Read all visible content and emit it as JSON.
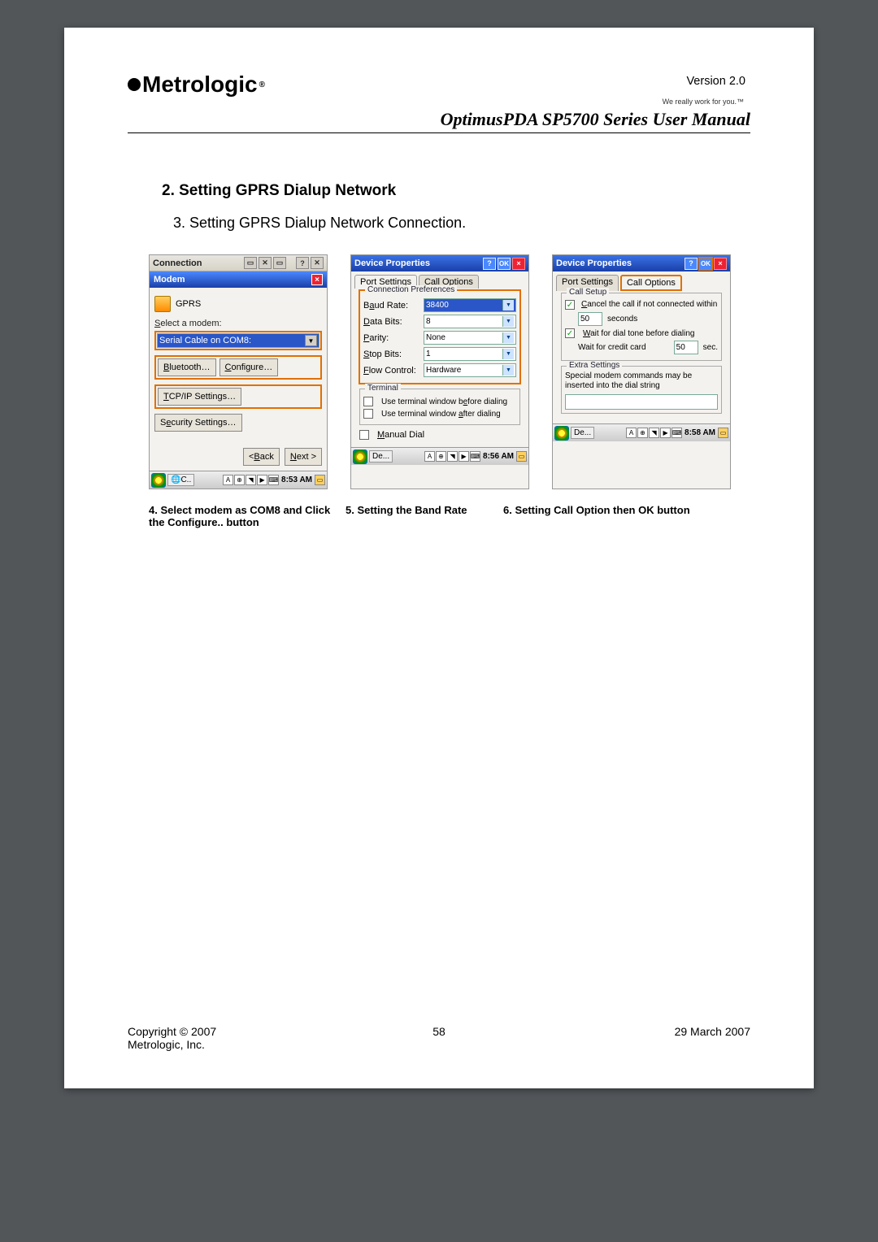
{
  "header": {
    "version": "Version 2.0",
    "logo_text": "Metrologic",
    "logo_tag": "We really work for you.™",
    "manual_title": "OptimusPDA SP5700 Series User Manual"
  },
  "section": {
    "heading": "2. Setting GPRS Dialup Network",
    "sub": "3. Setting GPRS Dialup Network Connection."
  },
  "shot1": {
    "window_title": "Connection",
    "sub_title": "Modem",
    "gprs": "GPRS",
    "select_modem_label": "Select a modem:",
    "modem_value": "Serial Cable on COM8:",
    "btn_bluetooth": "Bluetooth…",
    "btn_configure": "Configure…",
    "btn_tcpip": "TCP/IP Settings…",
    "btn_security": "Security Settings…",
    "btn_back": "< Back",
    "btn_next": "Next >",
    "task_label": "C..",
    "time": "8:53 AM"
  },
  "shot2": {
    "window_title": "Device Properties",
    "tab1": "Port Settings",
    "tab2": "Call Options",
    "fieldset1": "Connection Preferences",
    "baud_label": "Baud Rate:",
    "baud_value": "38400",
    "databits_label": "Data Bits:",
    "databits_value": "8",
    "parity_label": "Parity:",
    "parity_value": "None",
    "stopbits_label": "Stop Bits:",
    "stopbits_value": "1",
    "flow_label": "Flow Control:",
    "flow_value": "Hardware",
    "fieldset2": "Terminal",
    "term_before": "Use terminal window before dialing",
    "term_after": "Use terminal window after dialing",
    "manual_dial": "Manual Dial",
    "task_label": "De...",
    "time": "8:56 AM"
  },
  "shot3": {
    "window_title": "Device Properties",
    "tab1": "Port Settings",
    "tab2": "Call Options",
    "fieldset1": "Call Setup",
    "cancel_call": "Cancel the call if not connected within",
    "cancel_val": "50",
    "seconds": "seconds",
    "wait_dial": "Wait for dial tone before dialing",
    "wait_credit": "Wait for credit card",
    "wait_val": "50",
    "sec": "sec.",
    "fieldset2": "Extra Settings",
    "extra_text": "Special modem commands may be inserted into the dial string",
    "task_label": "De...",
    "time": "8:58 AM"
  },
  "captions": {
    "c1": "4. Select modem as COM8 and Click the Configure.. button",
    "c2": "5. Setting the Band Rate",
    "c3": "6. Setting Call Option  then OK button"
  },
  "footer": {
    "left1": "Copyright © 2007",
    "left2": "Metrologic, Inc.",
    "page": "58",
    "right": "29 March 2007"
  }
}
